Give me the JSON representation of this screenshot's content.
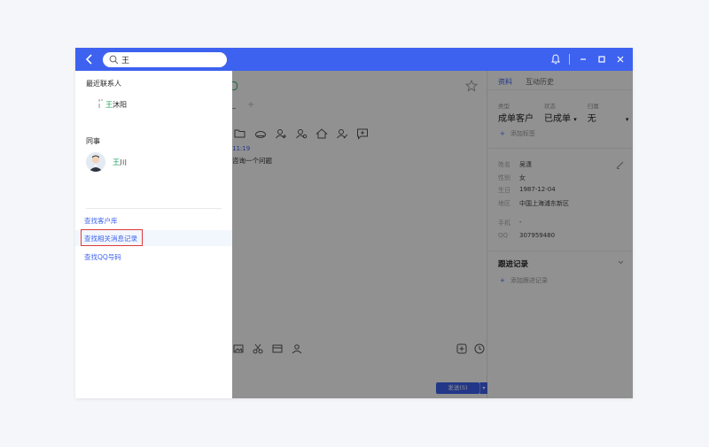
{
  "search": {
    "value": "王",
    "placeholder": ""
  },
  "dropdown": {
    "recent_title": "最近联系人",
    "recent_contact": {
      "highlight": "王",
      "rest": "沐阳"
    },
    "colleague_title": "同事",
    "colleague_contact": {
      "highlight": "王",
      "rest": "川"
    },
    "links": [
      "查找客户库",
      "查找相关消息记录",
      "查找QQ号码"
    ]
  },
  "chat": {
    "time": "11:19",
    "message": "咨询一个问题",
    "send_label": "发送(S)"
  },
  "right_panel": {
    "tabs": [
      "资料",
      "互动历史"
    ],
    "fields": [
      {
        "key": "类型",
        "value": "成单客户"
      },
      {
        "key": "状态",
        "value": "已成单"
      },
      {
        "key": "归属",
        "value": "无"
      }
    ],
    "add_tag": "添加标签",
    "info": [
      {
        "key": "姓名",
        "value": "吴潇"
      },
      {
        "key": "性别",
        "value": "女"
      },
      {
        "key": "生日",
        "value": "1987-12-04"
      },
      {
        "key": "地区",
        "value": "中国上海浦东新区"
      }
    ],
    "contact_info": [
      {
        "key": "手机",
        "value": "-"
      },
      {
        "key": "QQ",
        "value": "307959480"
      }
    ],
    "follow_title": "跟进记录",
    "add_follow": "添加跟进记录"
  },
  "colors": {
    "titlebar": "#3d62f0",
    "link": "#3d62f0",
    "match_highlight": "#1aa35b",
    "focus_box": "#e03a3a"
  },
  "icons": {
    "back": "chevron-left-icon",
    "search": "search-icon",
    "bell": "bell-icon",
    "minimize": "minimize-icon",
    "maximize": "maximize-icon",
    "close": "close-icon"
  }
}
